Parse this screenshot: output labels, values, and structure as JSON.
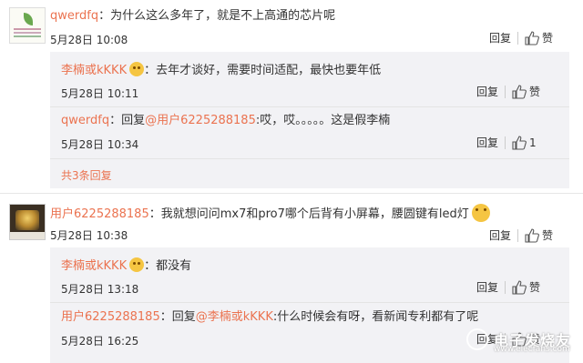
{
  "comments": [
    {
      "username": "qwerdfq",
      "separator": "：",
      "text": "为什么这么多年了，就是不上高通的芯片呢",
      "time": "5月28日 10:08",
      "reply_label": "回复",
      "like_label": "赞",
      "replies": [
        {
          "username": "李楠或kKKK",
          "separator": "：",
          "text": "去年才谈好，需要时间适配，最快也要年低",
          "time": "5月28日 10:11",
          "reply_label": "回复",
          "like_label": "赞"
        },
        {
          "username": "qwerdfq",
          "separator": "：",
          "reply_prefix": "回复",
          "mention": "@用户6225288185",
          "text": ":哎，哎。。。。。这是假李楠",
          "time": "5月28日 10:34",
          "reply_label": "回复",
          "like_count": "1"
        }
      ],
      "more_replies": "共3条回复"
    },
    {
      "username": "用户6225288185",
      "separator": "：",
      "text": "我就想问问mx7和pro7哪个后背有小屏幕，腰圆键有led灯",
      "time": "5月28日 10:38",
      "reply_label": "回复",
      "like_label": "赞",
      "replies": [
        {
          "username": "李楠或kKKK",
          "separator": "：",
          "text": "都没有",
          "time": "5月28日 13:18",
          "reply_label": "回复",
          "like_label": "赞"
        },
        {
          "username": "用户6225288185",
          "separator": "：",
          "reply_prefix": "回复",
          "mention": "@李楠或kKKK",
          "text": ":什么时候会有呀，看新闻专利都有了呢",
          "time": "5月28日 16:25",
          "reply_label": "回复",
          "like_label": "赞"
        }
      ]
    }
  ],
  "watermark": {
    "name": "电子发烧友",
    "url": "www.elecfans.com"
  },
  "colors": {
    "username": "#eb7350",
    "reply_box_bg": "#f2f2f5",
    "text": "#333333"
  },
  "icons": {
    "like": "thumbs-up-icon",
    "emoji": "smile-emoji-icon"
  }
}
